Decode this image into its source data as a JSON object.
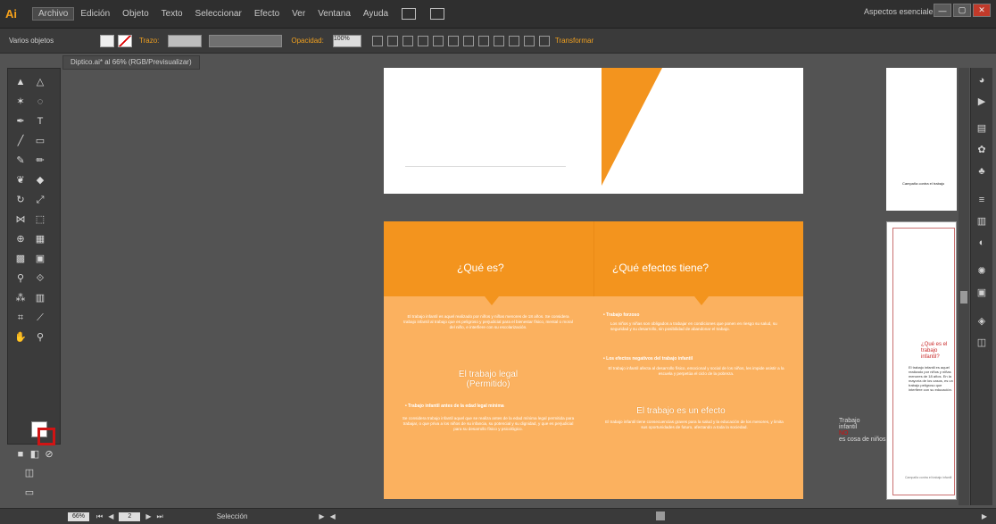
{
  "app": {
    "logo": "Ai",
    "menu": [
      "Archivo",
      "Edición",
      "Objeto",
      "Texto",
      "Seleccionar",
      "Efecto",
      "Ver",
      "Ventana",
      "Ayuda"
    ],
    "workspace": "Aspectos esenciales",
    "window_buttons": [
      "—",
      "▢",
      "✕"
    ]
  },
  "control_bar": {
    "selection_label": "Varios objetos",
    "stroke_label": "Trazo:",
    "opacity_label": "Opacidad:",
    "opacity_value": "100%",
    "transform_label": "Transformar"
  },
  "document": {
    "tab_title": "Diptico.ai* al 66% (RGB/Previsualizar)"
  },
  "status": {
    "zoom": "66%",
    "artboard_index": "2",
    "tool_name": "Selección"
  },
  "artwork": {
    "col1_title": "¿Qué es?",
    "col2_title": "¿Qué efectos tiene?",
    "col1_intro": "El trabajo infantil es aquel realizado por niños y niñas menores de 18 años. Se considera trabajo infantil al trabajo que es peligroso y perjudicial para el bienestar físico, mental o moral del niño, e interfiere con su escolarización.",
    "col1_subtitle": "El trabajo legal (Permitido)",
    "col1_bullet": "Trabajo infantil antes de la edad legal mínima",
    "col1_body": "Se considera trabajo infantil aquel que se realiza antes de la edad mínima legal permitida para trabajar, o que priva a los niños de su infancia, su potencial y su dignidad, y que es perjudicial para su desarrollo físico y psicológico.",
    "col2_bullet1": "Trabajo forzoso",
    "col2_body1": "Los niños y niñas son obligados a trabajar en condiciones que ponen en riesgo su salud, su seguridad y su desarrollo, sin posibilidad de abandonar el trabajo.",
    "col2_bullet2": "Los efectos negativos del trabajo infantil",
    "col2_body2": "El trabajo infantil afecta al desarrollo físico, emocional y social de los niños, les impide asistir a la escuela y perpetúa el ciclo de la pobreza.",
    "col2_subtitle": "El trabajo es un efecto",
    "col2_body3": "El trabajo infantil tiene consecuencias graves para la salud y la educación de los menores, y limita sus oportunidades de futuro, afectando a toda la sociedad.",
    "right_title": "¿Qué es el trabajo infantil?",
    "right_text": "El trabajo infantil es aquel realizado por niños y niñas menores de 18 años. En la mayoría de los casos, es un trabajo peligroso que interfiere con su educación.",
    "right_caption": "Campaña contra el trabajo",
    "right_footer": "Campaña contra el trabajo infantil",
    "floating_text": [
      "Trabajo",
      "infantil",
      "NO",
      "es cosa de niños"
    ]
  },
  "colors": {
    "accent": "#f7a21b",
    "orange_header": "#f3941e",
    "orange_body": "#fbb15f"
  }
}
